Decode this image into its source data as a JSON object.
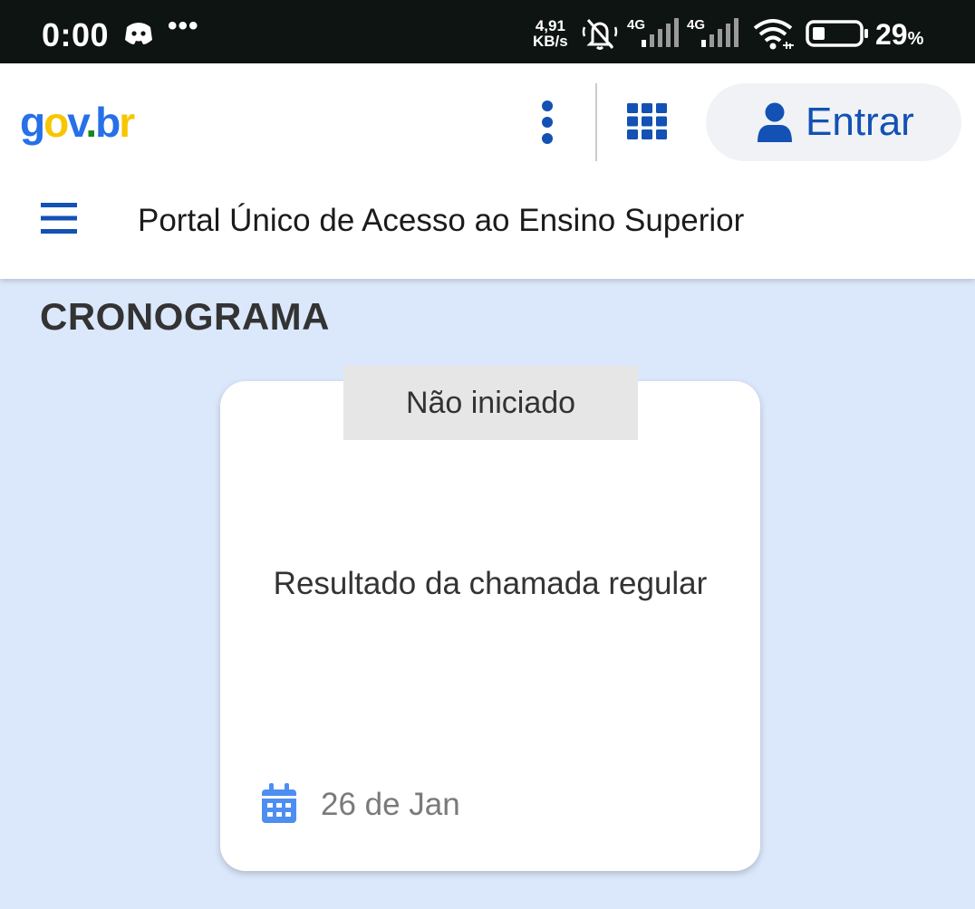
{
  "status_bar": {
    "time": "0:00",
    "more_dots": "•••",
    "net_speed_value": "4,91",
    "net_speed_unit": "KB/s",
    "signal1_label": "4G",
    "signal2_label": "4G",
    "battery_percent": "29",
    "battery_symbol": "%",
    "icons": [
      "discord-icon",
      "mute-icon",
      "signal-icon",
      "signal-icon",
      "wifi-icon",
      "battery-icon"
    ]
  },
  "header": {
    "logo": {
      "g": "g",
      "o": "o",
      "v": "v",
      "dot": ".",
      "b": "b",
      "r": "r"
    },
    "login_label": "Entrar",
    "portal_title": "Portal Único de Acesso ao Ensino Superior",
    "icons": [
      "kebab-menu-icon",
      "apps-grid-icon",
      "user-icon",
      "hamburger-menu-icon"
    ]
  },
  "content": {
    "section_title": "CRONOGRAMA",
    "card": {
      "status": "Não iniciado",
      "title": "Resultado da chamada regular",
      "date": "26 de Jan",
      "date_icon": "calendar-icon"
    }
  },
  "colors": {
    "brand_blue": "#1351b4",
    "background": "#dbe8fb",
    "status_tag_bg": "#e6e6e6",
    "calendar_blue": "#4e8ef0"
  }
}
